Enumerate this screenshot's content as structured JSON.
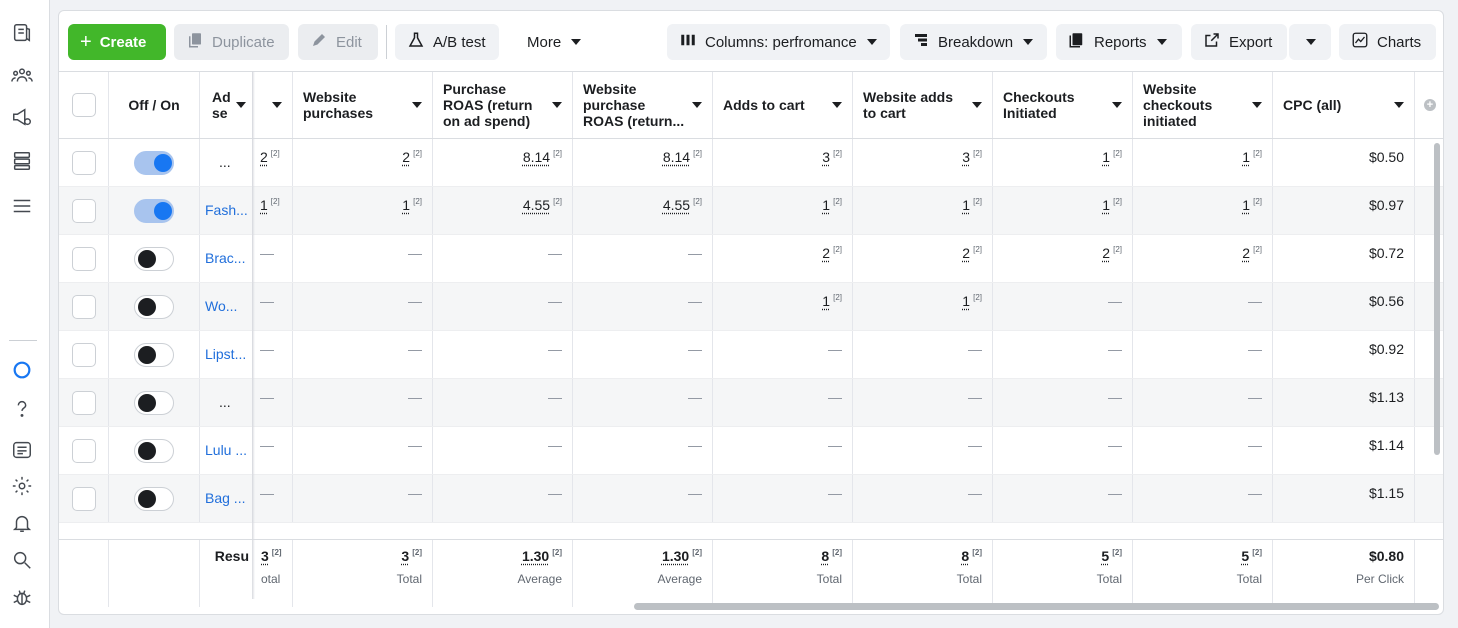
{
  "toolbar": {
    "create": "Create",
    "duplicate": "Duplicate",
    "edit": "Edit",
    "ab_test": "A/B test",
    "more": "More",
    "columns": "Columns: perfromance",
    "breakdown": "Breakdown",
    "reports": "Reports",
    "export": "Export",
    "charts": "Charts"
  },
  "columns": {
    "off_on": "Off / On",
    "ad_set": "Ad se",
    "website_purchases": "Website purchases",
    "purchase_roas": "Purchase ROAS (return on ad spend)",
    "website_purchase_roas": "Website purchase ROAS (return...",
    "adds_to_cart": "Adds to cart",
    "website_adds_to_cart": "Website adds to cart",
    "checkouts_initiated": "Checkouts Initiated",
    "website_checkouts_initiated": "Website checkouts initiated",
    "cpc_all": "CPC (all)"
  },
  "sup": "[2]",
  "rows": [
    {
      "on": true,
      "name": "...",
      "c0": "2",
      "c1": "2",
      "c2": "8.14",
      "c3": "8.14",
      "c4": "3",
      "c5": "3",
      "c6": "1",
      "c7": "1",
      "cpc": "$0.50"
    },
    {
      "on": true,
      "name": "Fash...",
      "c0": "1",
      "c1": "1",
      "c2": "4.55",
      "c3": "4.55",
      "c4": "1",
      "c5": "1",
      "c6": "1",
      "c7": "1",
      "cpc": "$0.97"
    },
    {
      "on": false,
      "name": "Brac...",
      "c0": "—",
      "c1": "—",
      "c2": "—",
      "c3": "—",
      "c4": "2",
      "c5": "2",
      "c6": "2",
      "c7": "2",
      "cpc": "$0.72"
    },
    {
      "on": false,
      "name": "Wo...",
      "c0": "—",
      "c1": "—",
      "c2": "—",
      "c3": "—",
      "c4": "1",
      "c5": "1",
      "c6": "—",
      "c7": "—",
      "cpc": "$0.56"
    },
    {
      "on": false,
      "name": "Lipst...",
      "c0": "—",
      "c1": "—",
      "c2": "—",
      "c3": "—",
      "c4": "—",
      "c5": "—",
      "c6": "—",
      "c7": "—",
      "cpc": "$0.92"
    },
    {
      "on": false,
      "name": "...",
      "c0": "—",
      "c1": "—",
      "c2": "—",
      "c3": "—",
      "c4": "—",
      "c5": "—",
      "c6": "—",
      "c7": "—",
      "cpc": "$1.13"
    },
    {
      "on": false,
      "name": "Lulu ...",
      "c0": "—",
      "c1": "—",
      "c2": "—",
      "c3": "—",
      "c4": "—",
      "c5": "—",
      "c6": "—",
      "c7": "—",
      "cpc": "$1.14"
    },
    {
      "on": false,
      "name": "Bag ...",
      "c0": "—",
      "c1": "—",
      "c2": "—",
      "c3": "—",
      "c4": "—",
      "c5": "—",
      "c6": "—",
      "c7": "—",
      "cpc": "$1.15"
    }
  ],
  "totals": {
    "label": "Resu",
    "c0": "3",
    "c0_sub": "otal",
    "c1": "3",
    "c1_sub": "Total",
    "c2": "1.30",
    "c2_sub": "Average",
    "c3": "1.30",
    "c3_sub": "Average",
    "c4": "8",
    "c4_sub": "Total",
    "c5": "8",
    "c5_sub": "Total",
    "c6": "5",
    "c6_sub": "Total",
    "c7": "5",
    "c7_sub": "Total",
    "cpc": "$0.80",
    "cpc_sub": "Per Click"
  },
  "rail_icons": [
    "campaigns-icon",
    "audiences-icon",
    "ads-manager-icon",
    "catalog-icon",
    "menu-icon",
    "meta-icon",
    "help-icon",
    "news-icon",
    "settings-icon",
    "notifications-icon",
    "search-icon",
    "bug-icon"
  ],
  "colors": {
    "create_green": "#42b72a",
    "link_blue": "#216fdb",
    "toggle_on": "#1877f2"
  }
}
